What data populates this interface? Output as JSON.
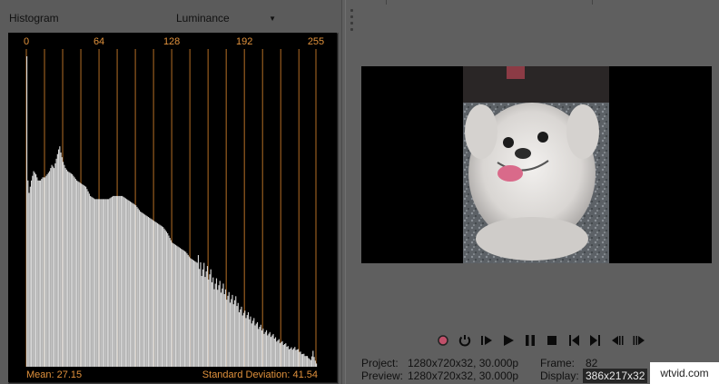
{
  "histogram": {
    "title": "Histogram",
    "mode": "Luminance",
    "ticks": [
      {
        "label": "0",
        "value": 0
      },
      {
        "label": "64",
        "value": 64
      },
      {
        "label": "128",
        "value": 128
      },
      {
        "label": "192",
        "value": 192
      },
      {
        "label": "255",
        "value": 255
      }
    ],
    "mean_label": "Mean: 27.15",
    "std_label": "Standard Deviation: 41.54",
    "colors": {
      "background": "#000000",
      "bars": "#d9d9d9",
      "gridlines": "#c87a2a",
      "labels": "#e0913c"
    }
  },
  "chart_data": {
    "type": "bar",
    "xlim": [
      0,
      255
    ],
    "ylim": [
      0,
      1
    ],
    "grid": true,
    "profile_x": [
      0,
      1,
      2,
      4,
      6,
      8,
      10,
      12,
      14,
      16,
      18,
      20,
      22,
      24,
      26,
      28,
      29,
      30,
      32,
      34,
      36,
      40,
      44,
      48,
      52,
      56,
      60,
      64,
      68,
      72,
      76,
      80,
      84,
      88,
      92,
      96,
      100,
      104,
      108,
      112,
      116,
      120,
      124,
      128,
      132,
      136,
      140,
      144,
      148,
      152,
      156,
      160,
      164,
      168,
      172,
      176,
      180,
      184,
      188,
      192,
      196,
      200,
      204,
      208,
      212,
      216,
      220,
      224,
      228,
      232,
      236,
      240,
      244,
      248,
      250,
      252,
      254,
      255
    ],
    "profile_y": [
      1.0,
      0.6,
      0.56,
      0.6,
      0.63,
      0.62,
      0.6,
      0.6,
      0.61,
      0.61,
      0.62,
      0.63,
      0.65,
      0.64,
      0.67,
      0.7,
      0.71,
      0.69,
      0.66,
      0.64,
      0.63,
      0.62,
      0.6,
      0.59,
      0.58,
      0.55,
      0.54,
      0.54,
      0.54,
      0.54,
      0.55,
      0.55,
      0.55,
      0.54,
      0.53,
      0.52,
      0.5,
      0.49,
      0.48,
      0.47,
      0.46,
      0.45,
      0.43,
      0.4,
      0.39,
      0.38,
      0.37,
      0.35,
      0.34,
      0.33,
      0.32,
      0.3,
      0.28,
      0.27,
      0.25,
      0.24,
      0.22,
      0.21,
      0.19,
      0.17,
      0.16,
      0.15,
      0.13,
      0.12,
      0.11,
      0.1,
      0.09,
      0.08,
      0.07,
      0.06,
      0.06,
      0.05,
      0.04,
      0.03,
      0.02,
      0.05,
      0.02,
      0.01
    ]
  },
  "transport": {
    "buttons": [
      {
        "name": "record-button",
        "icon": "record-icon"
      },
      {
        "name": "loop-button",
        "icon": "loop-icon"
      },
      {
        "name": "play-from-start-button",
        "icon": "play-from-start-icon"
      },
      {
        "name": "play-button",
        "icon": "play-icon"
      },
      {
        "name": "pause-button",
        "icon": "pause-icon"
      },
      {
        "name": "stop-button",
        "icon": "stop-icon"
      },
      {
        "name": "go-to-start-button",
        "icon": "go-to-start-icon"
      },
      {
        "name": "go-to-end-button",
        "icon": "go-to-end-icon"
      },
      {
        "name": "previous-frame-button",
        "icon": "previous-frame-icon"
      },
      {
        "name": "next-frame-button",
        "icon": "next-frame-icon"
      }
    ],
    "colors": {
      "record": "#c0506a",
      "icons": "#0b0b0b"
    }
  },
  "info": {
    "project_label": "Project:",
    "project_value": "1280x720x32, 30.000p",
    "preview_label": "Preview:",
    "preview_value": "1280x720x32, 30.000p",
    "frame_label": "Frame:",
    "frame_value": "82",
    "display_label": "Display:",
    "display_value": "386x217x32"
  },
  "watermark": "wtvid.com"
}
